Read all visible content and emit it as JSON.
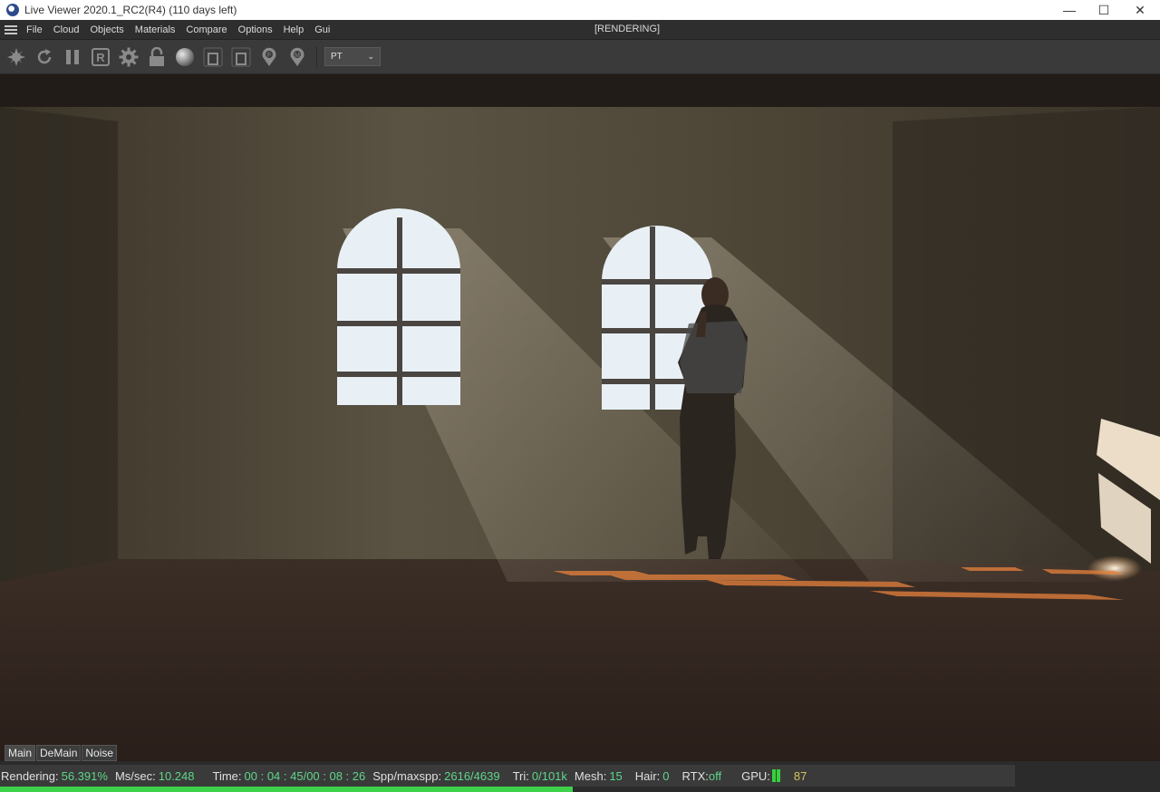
{
  "window": {
    "title": "Live Viewer 2020.1_RC2(R4) (110 days left)",
    "controls": [
      "minimize",
      "maximize",
      "close"
    ]
  },
  "menubar": {
    "items": [
      "File",
      "Cloud",
      "Objects",
      "Materials",
      "Compare",
      "Options",
      "Help",
      "Gui"
    ],
    "render_state": "[RENDERING]"
  },
  "toolbar": {
    "buttons": [
      {
        "name": "start-render-icon"
      },
      {
        "name": "restart-icon"
      },
      {
        "name": "pause-icon"
      },
      {
        "name": "region-render-icon"
      },
      {
        "name": "settings-gear-icon"
      },
      {
        "name": "lock-icon"
      },
      {
        "name": "material-sphere-icon"
      },
      {
        "name": "clay-mode-icon"
      },
      {
        "name": "subsampling-icon"
      },
      {
        "name": "focus-picker-icon"
      },
      {
        "name": "material-picker-icon"
      }
    ],
    "kernel_select": {
      "value": "PT"
    }
  },
  "tabs": [
    {
      "label": "Main",
      "active": true
    },
    {
      "label": "DeMain",
      "active": false
    },
    {
      "label": "Noise",
      "active": false
    }
  ],
  "status": {
    "rendering_label": "Rendering:",
    "rendering_value": "56.391%",
    "ms_label": "Ms/sec:",
    "ms_value": "10.248",
    "time_label": "Time:",
    "time_value": "00 : 04 : 45/00 : 08 : 26",
    "spp_label": "Spp/maxspp:",
    "spp_value": "2616/4639",
    "tri_label": "Tri:",
    "tri_value": "0/101k",
    "mesh_label": "Mesh:",
    "mesh_value": "15",
    "hair_label": "Hair:",
    "hair_value": "0",
    "rtx_label": "RTX:",
    "rtx_value": "off",
    "gpu_label": "GPU:",
    "gpu_temp": "87",
    "progress_fraction": 0.56391
  },
  "colors": {
    "progress": "#3ed14a",
    "status_value": "#5fd68a",
    "gpu_temp": "#d4c35a"
  }
}
